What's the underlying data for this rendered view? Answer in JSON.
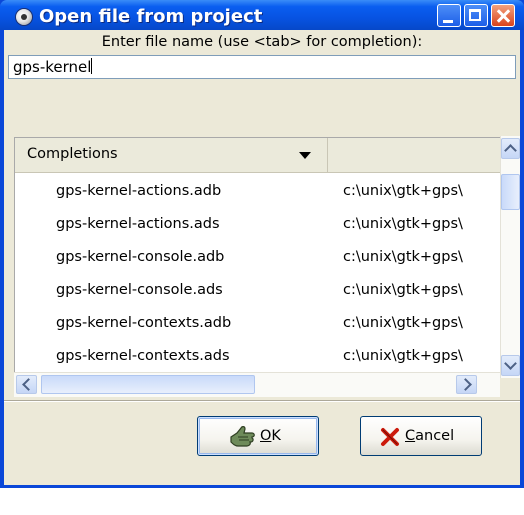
{
  "window": {
    "title": "Open file from project",
    "title_icon": "gps-app-icon",
    "controls": [
      "minimize-icon",
      "maximize-icon",
      "close-icon"
    ]
  },
  "prompt": {
    "label": "Enter file name (use <tab> for completion):",
    "value": "gps-kernel"
  },
  "completions": {
    "column_header": "Completions",
    "rows": [
      {
        "name": "gps-kernel-actions.adb",
        "path": "c:\\unix\\gtk+gps\\"
      },
      {
        "name": "gps-kernel-actions.ads",
        "path": "c:\\unix\\gtk+gps\\"
      },
      {
        "name": "gps-kernel-console.adb",
        "path": "c:\\unix\\gtk+gps\\"
      },
      {
        "name": "gps-kernel-console.ads",
        "path": "c:\\unix\\gtk+gps\\"
      },
      {
        "name": "gps-kernel-contexts.adb",
        "path": "c:\\unix\\gtk+gps\\"
      },
      {
        "name": "gps-kernel-contexts.ads",
        "path": "c:\\unix\\gtk+gps\\"
      }
    ]
  },
  "buttons": {
    "ok": {
      "mnemonic": "O",
      "rest": "K",
      "icon": "ok-hand-icon"
    },
    "cancel": {
      "mnemonic": "C",
      "rest": "ancel",
      "icon": "red-x-icon"
    }
  },
  "colors": {
    "titlebar": "#0a5ef0",
    "dialog_bg": "#ece9d8",
    "close_button": "#d9431c"
  }
}
